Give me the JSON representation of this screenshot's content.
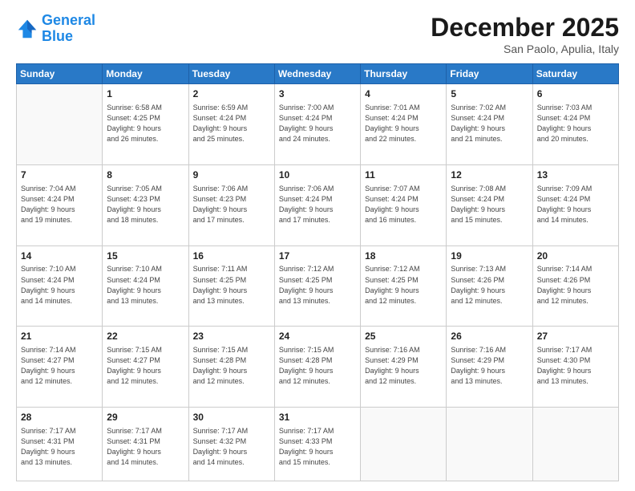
{
  "header": {
    "logo_line1": "General",
    "logo_line2": "Blue",
    "title": "December 2025",
    "location": "San Paolo, Apulia, Italy"
  },
  "days_of_week": [
    "Sunday",
    "Monday",
    "Tuesday",
    "Wednesday",
    "Thursday",
    "Friday",
    "Saturday"
  ],
  "weeks": [
    [
      {
        "day": "",
        "info": ""
      },
      {
        "day": "1",
        "info": "Sunrise: 6:58 AM\nSunset: 4:25 PM\nDaylight: 9 hours\nand 26 minutes."
      },
      {
        "day": "2",
        "info": "Sunrise: 6:59 AM\nSunset: 4:24 PM\nDaylight: 9 hours\nand 25 minutes."
      },
      {
        "day": "3",
        "info": "Sunrise: 7:00 AM\nSunset: 4:24 PM\nDaylight: 9 hours\nand 24 minutes."
      },
      {
        "day": "4",
        "info": "Sunrise: 7:01 AM\nSunset: 4:24 PM\nDaylight: 9 hours\nand 22 minutes."
      },
      {
        "day": "5",
        "info": "Sunrise: 7:02 AM\nSunset: 4:24 PM\nDaylight: 9 hours\nand 21 minutes."
      },
      {
        "day": "6",
        "info": "Sunrise: 7:03 AM\nSunset: 4:24 PM\nDaylight: 9 hours\nand 20 minutes."
      }
    ],
    [
      {
        "day": "7",
        "info": "Sunrise: 7:04 AM\nSunset: 4:24 PM\nDaylight: 9 hours\nand 19 minutes."
      },
      {
        "day": "8",
        "info": "Sunrise: 7:05 AM\nSunset: 4:23 PM\nDaylight: 9 hours\nand 18 minutes."
      },
      {
        "day": "9",
        "info": "Sunrise: 7:06 AM\nSunset: 4:23 PM\nDaylight: 9 hours\nand 17 minutes."
      },
      {
        "day": "10",
        "info": "Sunrise: 7:06 AM\nSunset: 4:24 PM\nDaylight: 9 hours\nand 17 minutes."
      },
      {
        "day": "11",
        "info": "Sunrise: 7:07 AM\nSunset: 4:24 PM\nDaylight: 9 hours\nand 16 minutes."
      },
      {
        "day": "12",
        "info": "Sunrise: 7:08 AM\nSunset: 4:24 PM\nDaylight: 9 hours\nand 15 minutes."
      },
      {
        "day": "13",
        "info": "Sunrise: 7:09 AM\nSunset: 4:24 PM\nDaylight: 9 hours\nand 14 minutes."
      }
    ],
    [
      {
        "day": "14",
        "info": "Sunrise: 7:10 AM\nSunset: 4:24 PM\nDaylight: 9 hours\nand 14 minutes."
      },
      {
        "day": "15",
        "info": "Sunrise: 7:10 AM\nSunset: 4:24 PM\nDaylight: 9 hours\nand 13 minutes."
      },
      {
        "day": "16",
        "info": "Sunrise: 7:11 AM\nSunset: 4:25 PM\nDaylight: 9 hours\nand 13 minutes."
      },
      {
        "day": "17",
        "info": "Sunrise: 7:12 AM\nSunset: 4:25 PM\nDaylight: 9 hours\nand 13 minutes."
      },
      {
        "day": "18",
        "info": "Sunrise: 7:12 AM\nSunset: 4:25 PM\nDaylight: 9 hours\nand 12 minutes."
      },
      {
        "day": "19",
        "info": "Sunrise: 7:13 AM\nSunset: 4:26 PM\nDaylight: 9 hours\nand 12 minutes."
      },
      {
        "day": "20",
        "info": "Sunrise: 7:14 AM\nSunset: 4:26 PM\nDaylight: 9 hours\nand 12 minutes."
      }
    ],
    [
      {
        "day": "21",
        "info": "Sunrise: 7:14 AM\nSunset: 4:27 PM\nDaylight: 9 hours\nand 12 minutes."
      },
      {
        "day": "22",
        "info": "Sunrise: 7:15 AM\nSunset: 4:27 PM\nDaylight: 9 hours\nand 12 minutes."
      },
      {
        "day": "23",
        "info": "Sunrise: 7:15 AM\nSunset: 4:28 PM\nDaylight: 9 hours\nand 12 minutes."
      },
      {
        "day": "24",
        "info": "Sunrise: 7:15 AM\nSunset: 4:28 PM\nDaylight: 9 hours\nand 12 minutes."
      },
      {
        "day": "25",
        "info": "Sunrise: 7:16 AM\nSunset: 4:29 PM\nDaylight: 9 hours\nand 12 minutes."
      },
      {
        "day": "26",
        "info": "Sunrise: 7:16 AM\nSunset: 4:29 PM\nDaylight: 9 hours\nand 13 minutes."
      },
      {
        "day": "27",
        "info": "Sunrise: 7:17 AM\nSunset: 4:30 PM\nDaylight: 9 hours\nand 13 minutes."
      }
    ],
    [
      {
        "day": "28",
        "info": "Sunrise: 7:17 AM\nSunset: 4:31 PM\nDaylight: 9 hours\nand 13 minutes."
      },
      {
        "day": "29",
        "info": "Sunrise: 7:17 AM\nSunset: 4:31 PM\nDaylight: 9 hours\nand 14 minutes."
      },
      {
        "day": "30",
        "info": "Sunrise: 7:17 AM\nSunset: 4:32 PM\nDaylight: 9 hours\nand 14 minutes."
      },
      {
        "day": "31",
        "info": "Sunrise: 7:17 AM\nSunset: 4:33 PM\nDaylight: 9 hours\nand 15 minutes."
      },
      {
        "day": "",
        "info": ""
      },
      {
        "day": "",
        "info": ""
      },
      {
        "day": "",
        "info": ""
      }
    ]
  ]
}
